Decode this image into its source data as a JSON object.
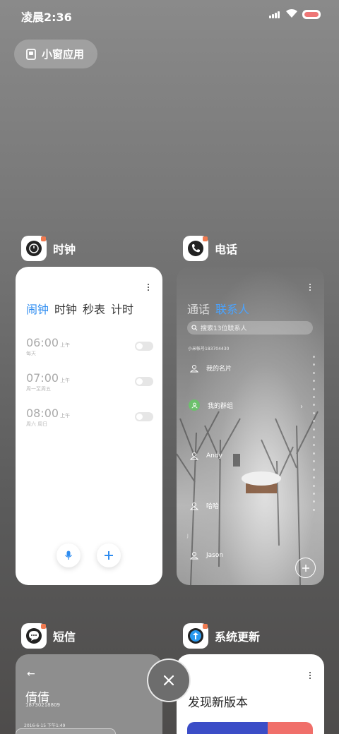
{
  "status_bar": {
    "time": "凌晨2:36",
    "icons": [
      "signal-icon",
      "wifi-icon",
      "battery-icon"
    ]
  },
  "small_window": {
    "label": "小窗应用",
    "icon": "small-window-icon"
  },
  "apps": [
    {
      "name": "时钟",
      "icon": "clock-app-icon"
    },
    {
      "name": "电话",
      "icon": "phone-app-icon"
    },
    {
      "name": "短信",
      "icon": "sms-app-icon"
    },
    {
      "name": "系统更新",
      "icon": "system-update-app-icon"
    }
  ],
  "clock": {
    "tabs": [
      "闹钟",
      "时钟",
      "秒表",
      "计时"
    ],
    "active_tab": 0,
    "alarms": [
      {
        "time": "06:00",
        "ampm": "上午",
        "repeat": "每天"
      },
      {
        "time": "07:00",
        "ampm": "上午",
        "repeat": "周一至周五"
      },
      {
        "time": "08:00",
        "ampm": "上午",
        "repeat": "周六 周日"
      }
    ],
    "accent_color": "#2e8cf0"
  },
  "contacts": {
    "tabs": [
      "通话",
      "联系人"
    ],
    "active_tab": 1,
    "search_placeholder": "搜索13位联系人",
    "account": "小米帐号183704430",
    "rows": [
      {
        "label": "我的名片",
        "icon": "contact-person-icon"
      },
      {
        "label": "我的群组",
        "icon": "group-icon"
      },
      {
        "label": "Andy",
        "icon": "contact-person-icon"
      },
      {
        "label": "哈哈",
        "icon": "contact-person-icon"
      },
      {
        "label": "Jason",
        "icon": "contact-person-icon"
      }
    ],
    "index_letter": "J",
    "accent_color": "#4aa3ff"
  },
  "sms": {
    "contact_name": "倩倩",
    "contact_number": "18730218809",
    "date": "2016-6-15 下午1:49"
  },
  "update": {
    "title": "发现新版本"
  }
}
